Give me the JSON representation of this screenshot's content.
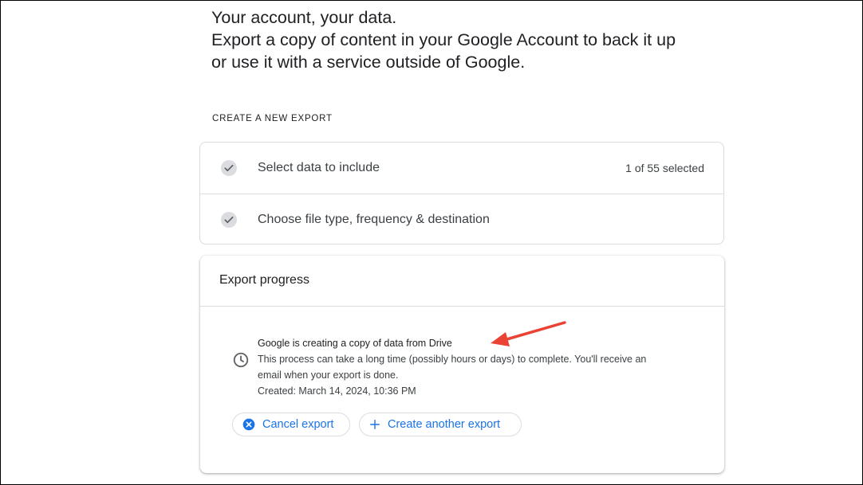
{
  "intro": {
    "line1": "Your account, your data.",
    "line2": "Export a copy of content in your Google Account to back it up",
    "line3": "or use it with a service outside of Google."
  },
  "section_label": "CREATE A NEW EXPORT",
  "steps": [
    {
      "label": "Select data to include",
      "count": "1 of 55 selected",
      "icon": "check-icon"
    },
    {
      "label": "Choose file type, frequency & destination",
      "icon": "check-icon"
    }
  ],
  "progress": {
    "title": "Export progress",
    "status_main": "Google is creating a copy of data from Drive",
    "status_note_1": "This process can take a long time (possibly hours or days) to complete. You'll receive an",
    "status_note_2": "email when your export is done.",
    "created": "Created: March 14, 2024, 10:36 PM",
    "icon": "clock-icon"
  },
  "buttons": {
    "cancel": "Cancel export",
    "create": "Create another export"
  },
  "colors": {
    "accent": "#1a73e8",
    "annotation_arrow": "#ea4335",
    "divider": "#dadce0"
  }
}
